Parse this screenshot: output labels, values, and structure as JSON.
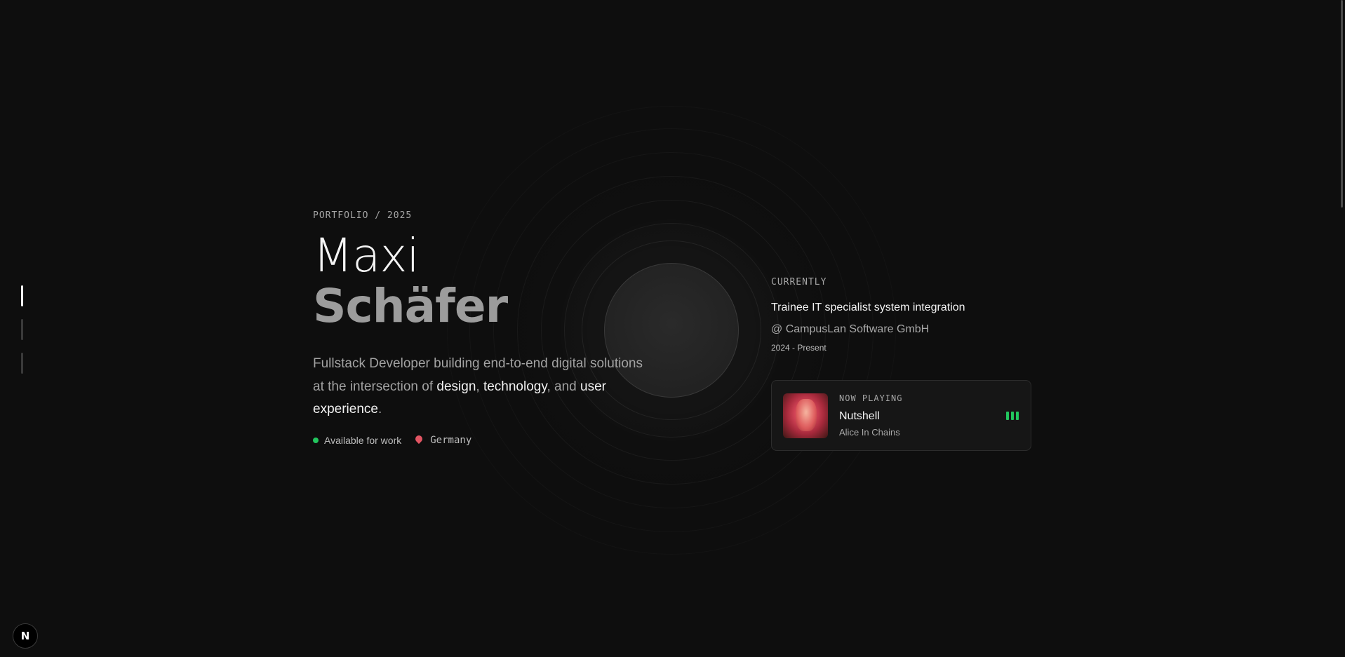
{
  "hero": {
    "eyebrow": "PORTFOLIO / 2025",
    "first_name": "Maxi",
    "last_name": "Schäfer",
    "tagline_parts": {
      "p1": "Fullstack Developer building end-to-end digital solutions at the intersection of ",
      "h1": "design",
      "p2": ", ",
      "h2": "technology",
      "p3": ", and ",
      "h3": "user experience",
      "p4": "."
    },
    "availability": "Available for work",
    "location": "Germany"
  },
  "current": {
    "label": "CURRENTLY",
    "role": "Trainee IT specialist system integration",
    "company": "@ CampusLan Software GmbH",
    "period": "2024 - Present"
  },
  "now_playing": {
    "label": "NOW PLAYING",
    "track": "Nutshell",
    "artist": "Alice In Chains"
  },
  "logo": {
    "letter": "N"
  },
  "icons": {
    "pin": "map-pin-icon",
    "equalizer": "equalizer-icon",
    "status": "status-dot-icon"
  },
  "colors": {
    "background": "#0e0e0e",
    "accent_green": "#22c55e",
    "pin_red": "#e25563"
  }
}
